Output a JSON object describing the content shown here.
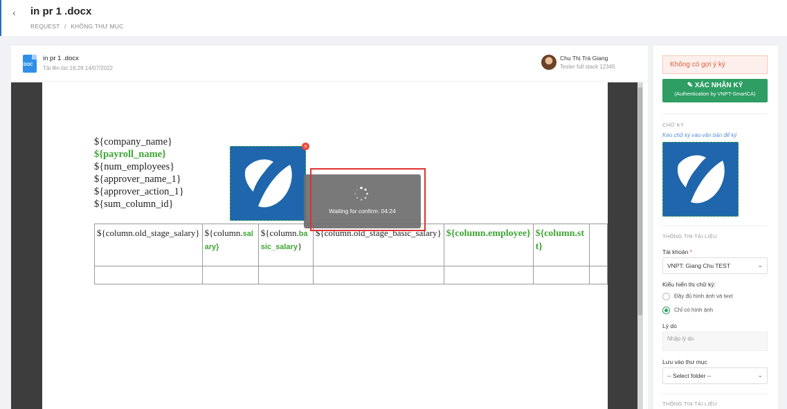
{
  "header": {
    "back_icon": "chevron-left-icon",
    "title": "in pr 1 .docx",
    "breadcrumb": [
      "REQUEST",
      "/",
      "KHÔNG THƯ MỤC"
    ]
  },
  "document": {
    "file_type": "DOC",
    "name": "in pr 1 .docx",
    "uploaded": "Tải lên lúc 16:26 14/07/2022",
    "user_name": "Chu Thị Trà Giang",
    "user_role": "Tester full stack 12345"
  },
  "page_content": {
    "vars": [
      {
        "text": "${company_name}",
        "green": false
      },
      {
        "text": "${payroll_name}",
        "green": true
      },
      {
        "text": "${num_employees}",
        "green": false
      },
      {
        "text": "${approver_name_1}",
        "green": false
      },
      {
        "text": "${approver_action_1}",
        "green": false
      },
      {
        "text": "${sum_column_id}",
        "green": false
      }
    ],
    "table_row": {
      "c1": "${column.old_stage_salary}",
      "c2a": "${column.",
      "c2b": "sal",
      "c2c": "ary}",
      "c3a": "${column.",
      "c3b": "ba",
      "c3c": "sic_salary",
      "c3d": "}",
      "c4": "${column.old_stage_basic_salary}",
      "c5": "${column.employee}",
      "c6": "${column.st t}"
    }
  },
  "modal": {
    "text": "Waiting for confirm: 04:24"
  },
  "sidebar": {
    "alert": "Không có gợi ý ký",
    "sign_button": "XÁC NHẬN KÝ",
    "sign_button_sub": "(Authentication by VNPT-SmartCA)",
    "signature_section": "CHỮ KÝ",
    "signature_hint": "Kéo chữ ký vào văn bản để ký",
    "doc_info_section": "THÔNG TIN TÀI LIỆU",
    "account_label": "Tài khoản",
    "account_value": "VNPT: Giang Chu TEST",
    "display_label": "Kiểu hiển thị chữ ký:",
    "option_full": "Đầy đủ hình ảnh và text",
    "option_image": "Chỉ có hình ảnh",
    "reason_label": "Lý do",
    "reason_placeholder": "Nhập lý do",
    "folder_label": "Lưu vào thư mục",
    "folder_value": "-- Select folder --",
    "doc_info_section2": "THÔNG TIN TÀI LIỆU"
  },
  "colors": {
    "accent_green": "#2e9e64",
    "vnpt_blue": "#1f66ac",
    "highlight_red": "#e03030"
  }
}
